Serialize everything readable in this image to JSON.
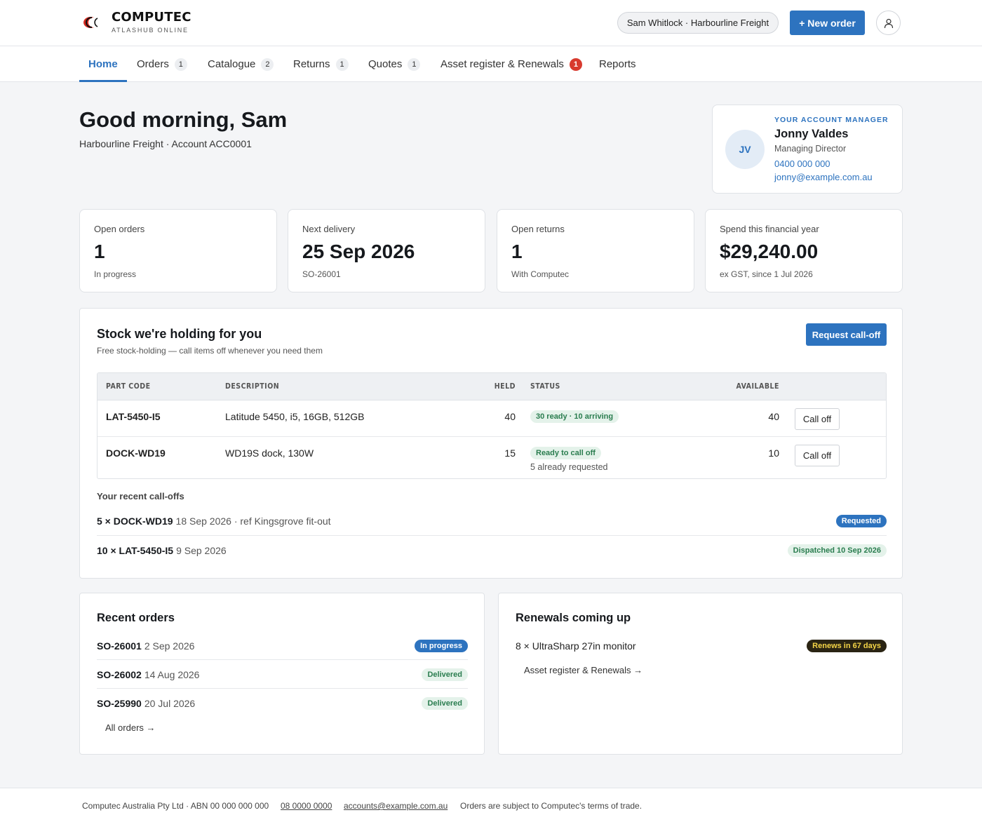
{
  "brand": {
    "name": "COMPUTEC",
    "tagline": "ATLASHUB ONLINE"
  },
  "header": {
    "account": "Sam Whitlock · Harbourline Freight",
    "new_order": "+ New order",
    "user_icon": "user-icon"
  },
  "nav": {
    "tabs": [
      {
        "label": "Home",
        "count": null
      },
      {
        "label": "Orders",
        "count": "1"
      },
      {
        "label": "Catalogue",
        "count": "2"
      },
      {
        "label": "Returns",
        "count": "1"
      },
      {
        "label": "Quotes",
        "count": "1"
      },
      {
        "label": "Asset register & Renewals",
        "count": "1"
      },
      {
        "label": "Reports",
        "count": null
      }
    ]
  },
  "greeting": {
    "title": "Good morning, Sam",
    "subtitle": "Harbourline Freight · Account ACC0001"
  },
  "manager": {
    "label": "YOUR ACCOUNT MANAGER",
    "initials": "JV",
    "name": "Jonny Valdes",
    "role": "Managing Director",
    "phone": "0400 000 000",
    "email": "jonny@example.com.au"
  },
  "stats": [
    {
      "label": "Open orders",
      "value": "1",
      "sub": "In progress"
    },
    {
      "label": "Next delivery",
      "value": "25 Sep 2026",
      "sub": "SO-26001"
    },
    {
      "label": "Open returns",
      "value": "1",
      "sub": "With Computec"
    },
    {
      "label": "Spend this financial year",
      "value": "$29,240.00",
      "sub": "ex GST, since 1 Jul 2026"
    }
  ],
  "stock": {
    "title": "Stock we're holding for you",
    "subtitle": "Free stock-holding — call items off whenever you need them",
    "request_btn": "Request call-off",
    "columns": {
      "part": "PART CODE",
      "desc": "DESCRIPTION",
      "held": "HELD",
      "status": "STATUS",
      "available": "AVAILABLE"
    },
    "rows": [
      {
        "part": "LAT-5450-I5",
        "desc": "Latitude 5450, i5, 16GB, 512GB",
        "held": "40",
        "status": "30 ready · 10 arriving",
        "note": "",
        "available": "40",
        "action": "Call off"
      },
      {
        "part": "DOCK-WD19",
        "desc": "WD19S dock, 130W",
        "held": "15",
        "status": "Ready to call off",
        "note": "5 already requested",
        "available": "10",
        "action": "Call off"
      }
    ],
    "recent_label": "Your recent call-offs",
    "recent": [
      {
        "item": "5 × DOCK-WD19",
        "detail": "18 Sep 2026 · ref Kingsgrove fit-out",
        "status": "Requested"
      },
      {
        "item": "10 × LAT-5450-I5",
        "detail": "9 Sep 2026",
        "status": "Dispatched 10 Sep 2026"
      }
    ]
  },
  "recent_orders": {
    "title": "Recent orders",
    "items": [
      {
        "id": "SO-26001",
        "date": "2 Sep 2026",
        "status": "In progress"
      },
      {
        "id": "SO-26002",
        "date": "14 Aug 2026",
        "status": "Delivered"
      },
      {
        "id": "SO-25990",
        "date": "20 Jul 2026",
        "status": "Delivered"
      }
    ],
    "link": "All orders →"
  },
  "renewals": {
    "title": "Renewals coming up",
    "items": [
      {
        "item": "8 × UltraSharp 27in monitor",
        "status": "Renews in 67 days"
      }
    ],
    "link": "Asset register & Renewals →"
  },
  "footer": {
    "company": "Computec Australia Pty Ltd · ABN 00 000 000 000",
    "phone": "08 0000 0000",
    "email": "accounts@example.com.au",
    "terms": "Orders are subject to Computec's terms of trade."
  }
}
